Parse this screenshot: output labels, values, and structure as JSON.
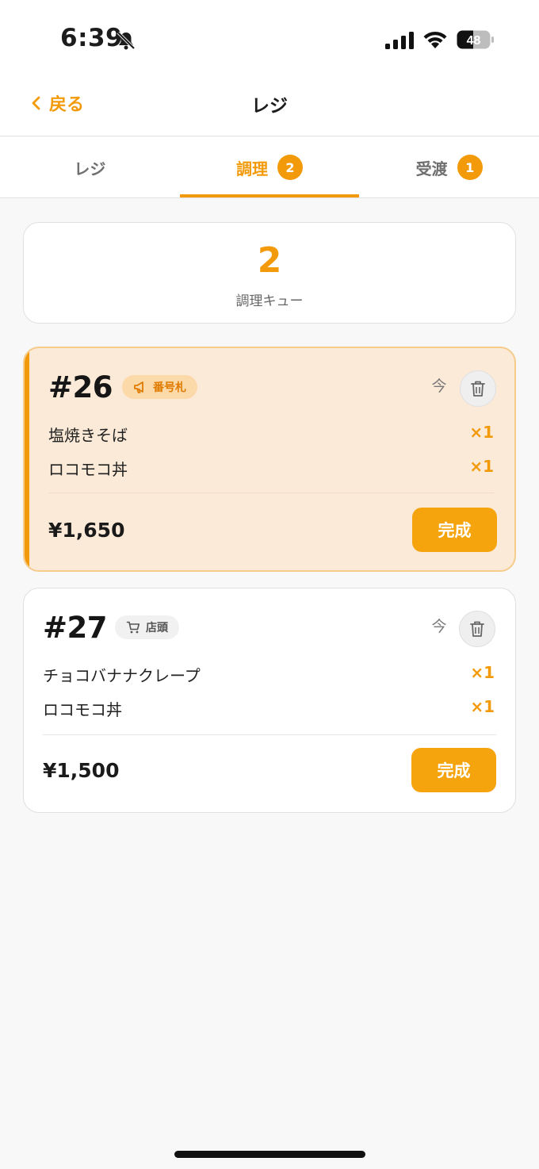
{
  "status_bar": {
    "time": "6:39",
    "battery": "48",
    "icons": [
      "bell-slash-icon",
      "cellular-signal-icon",
      "wifi-icon",
      "battery-icon"
    ]
  },
  "nav": {
    "back_label": "戻る",
    "title": "レジ"
  },
  "tabs": [
    {
      "label": "レジ",
      "badge": null,
      "active": false
    },
    {
      "label": "調理",
      "badge": "2",
      "active": true
    },
    {
      "label": "受渡",
      "badge": "1",
      "active": false
    }
  ],
  "summary": {
    "count": "2",
    "label": "調理キュー"
  },
  "orders": [
    {
      "number": "#26",
      "tag": {
        "label": "番号札",
        "icon": "megaphone-icon"
      },
      "time_icon": "clock-icon",
      "time_glyph": "今",
      "items": [
        {
          "name": "塩焼きそば",
          "qty": "×1"
        },
        {
          "name": "ロコモコ丼",
          "qty": "×1"
        }
      ],
      "total": "¥1,650",
      "action_label": "完成",
      "highlighted": true
    },
    {
      "number": "#27",
      "tag": {
        "label": "店頭",
        "icon": "cart-icon"
      },
      "time_icon": "clock-icon",
      "time_glyph": "今",
      "items": [
        {
          "name": "チョコバナナクレープ",
          "qty": "×1"
        },
        {
          "name": "ロコモコ丼",
          "qty": "×1"
        }
      ],
      "total": "¥1,500",
      "action_label": "完成",
      "highlighted": false
    }
  ],
  "colors": {
    "accent": "#f39a0b",
    "highlight_card_bg": "#fbead7",
    "page_bg": "#f8f8f8"
  }
}
